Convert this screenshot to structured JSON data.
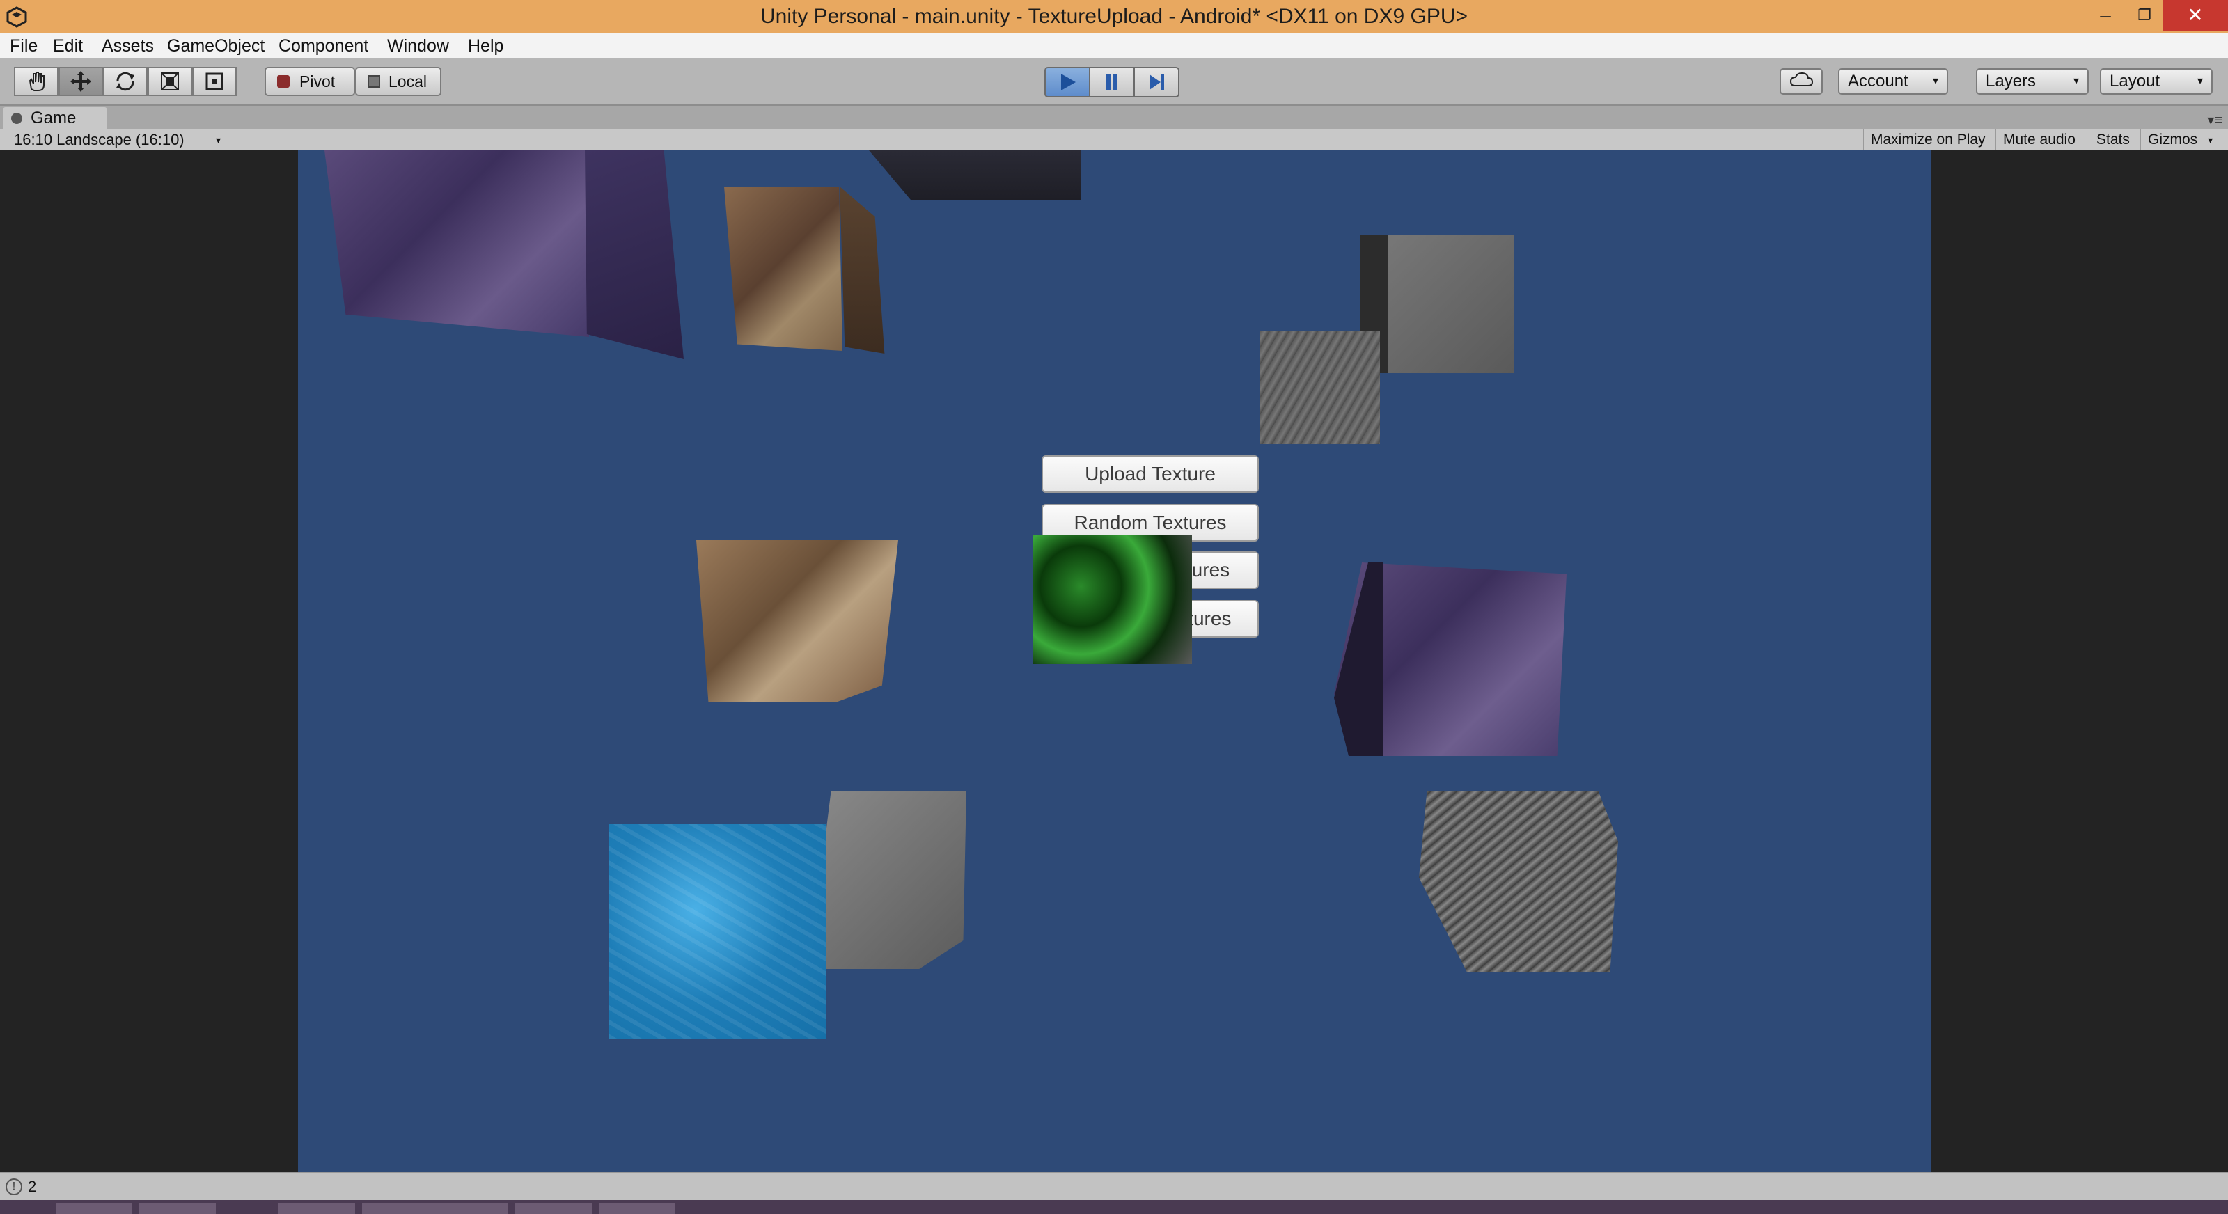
{
  "window": {
    "title": "Unity Personal - main.unity - TextureUpload - Android* <DX11 on DX9 GPU>",
    "minimize_glyph": "–",
    "restore_glyph": "❐",
    "close_glyph": "✕"
  },
  "menu": {
    "items": [
      "File",
      "Edit",
      "Assets",
      "GameObject",
      "Component",
      "Window",
      "Help"
    ]
  },
  "toolbar": {
    "pivot_label": "Pivot",
    "local_label": "Local",
    "account_label": "Account",
    "layers_label": "Layers",
    "layout_label": "Layout",
    "caret": "▾"
  },
  "tab": {
    "label": "Game",
    "menu_glyph": "▾≡"
  },
  "gamebar": {
    "aspect": "16:10 Landscape (16:10)",
    "maximize_on_play": "Maximize on Play",
    "mute_audio": "Mute audio",
    "stats": "Stats",
    "gizmos": "Gizmos"
  },
  "game_ui": {
    "buttons": [
      "Upload Texture",
      "Random Textures",
      "Latest 10 Textures",
      "Oldest 10 Textures"
    ]
  },
  "status": {
    "icon_glyph": "!",
    "text": "2"
  },
  "colors": {
    "title_bar": "#e8a860",
    "scene_background": "#2e4a77",
    "play_active": "#5e8ccb"
  }
}
